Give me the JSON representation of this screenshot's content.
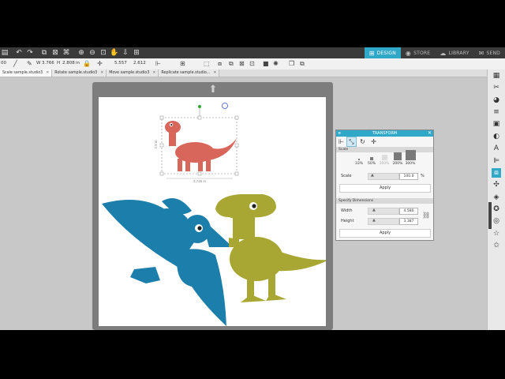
{
  "toolbar": {
    "icons": [
      "print-icon",
      "undo-icon",
      "redo-icon",
      "group-icon",
      "ungroup-icon",
      "compound-icon",
      "zoom-in-icon",
      "zoom-out-icon",
      "zoom-fit-icon",
      "pan-icon",
      "drag-icon",
      "move-down-icon",
      "zoom-select-icon"
    ]
  },
  "nav": {
    "design": "DESIGN",
    "store": "STORE",
    "library": "LIBRARY",
    "send": "SEND",
    "accent_color": "#30a8c8"
  },
  "options": {
    "unit_trail": "00",
    "w_label": "W",
    "w_value": "3.766",
    "h_label": "H",
    "h_value": "2.808",
    "unit": "in",
    "x_value": "5.557",
    "y_value": "2.612"
  },
  "tabs": [
    {
      "label": "Scale sample.studio3"
    },
    {
      "label": "Rotate sample.studio3"
    },
    {
      "label": "Move sample.studio3"
    },
    {
      "label": "Replicate sample.studio..."
    }
  ],
  "selection": {
    "height_label": "2.8 in",
    "width_label": "3.745 in"
  },
  "transform": {
    "title": "TRANSFORM",
    "scale_section": "Scale",
    "presets": [
      "33%",
      "50%",
      "100%",
      "200%",
      "300%"
    ],
    "scale_label": "Scale",
    "scale_value": "100.0",
    "percent": "%",
    "apply": "Apply",
    "dims_section": "Specify Dimensions",
    "width_label": "Width",
    "width_value": "4.580",
    "height_label": "Height",
    "height_value": "3.387",
    "apply2": "Apply"
  },
  "art_colors": {
    "small_dino": "#d9665a",
    "pterodactyl": "#1c7fab",
    "trex": "#a8a733"
  }
}
